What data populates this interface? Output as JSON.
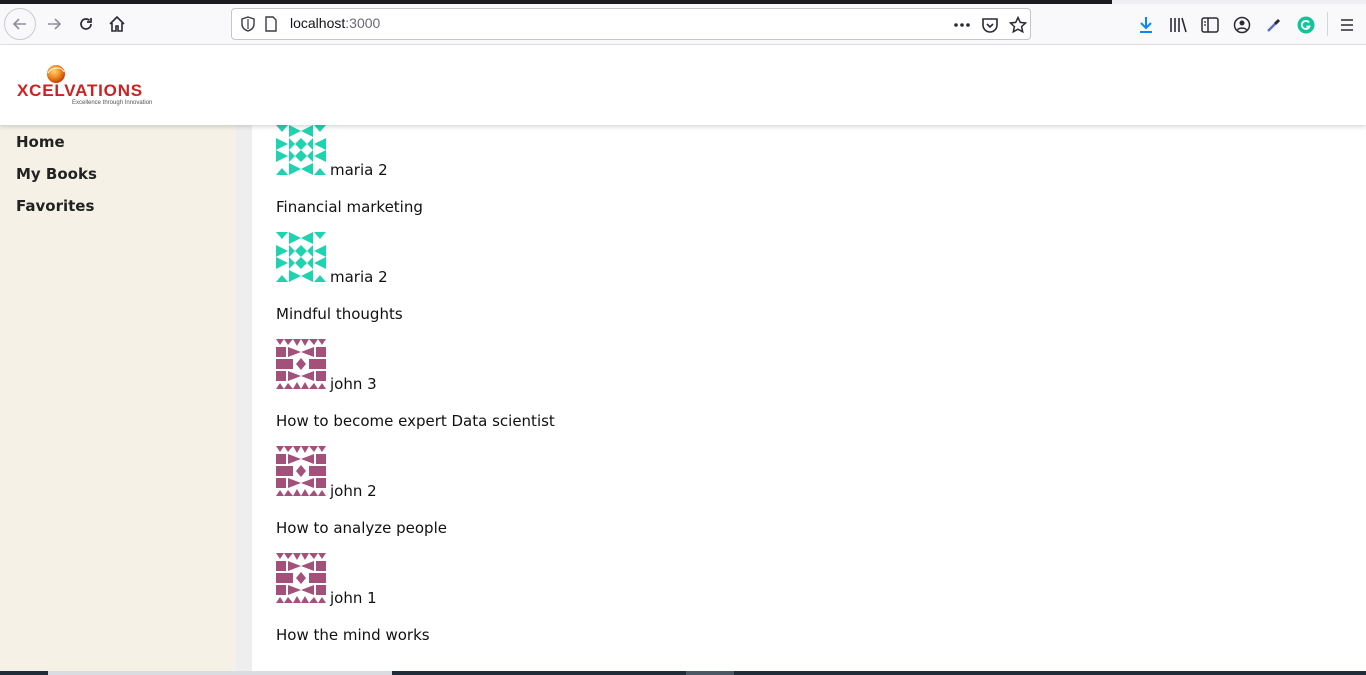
{
  "browser": {
    "url_host": "localhost",
    "url_port": ":3000"
  },
  "app": {
    "logo_text": "XCELVATIONS",
    "logo_tagline": "Excellence through Innovation",
    "brand_color": "#cc2222"
  },
  "sidebar": {
    "items": [
      {
        "label": "Home"
      },
      {
        "label": "My Books"
      },
      {
        "label": "Favorites"
      }
    ]
  },
  "feed": {
    "items": [
      {
        "author": "maria 2",
        "title": "Financial marketing",
        "avatar_color": "#1fd3b0"
      },
      {
        "author": "maria 2",
        "title": "Mindful thoughts",
        "avatar_color": "#1fd3b0"
      },
      {
        "author": "john 3",
        "title": "How to become expert Data scientist",
        "avatar_color": "#a3507a"
      },
      {
        "author": "john 2",
        "title": "How to analyze people",
        "avatar_color": "#a3507a"
      },
      {
        "author": "john 1",
        "title": "How the mind works",
        "avatar_color": "#a3507a"
      }
    ]
  }
}
